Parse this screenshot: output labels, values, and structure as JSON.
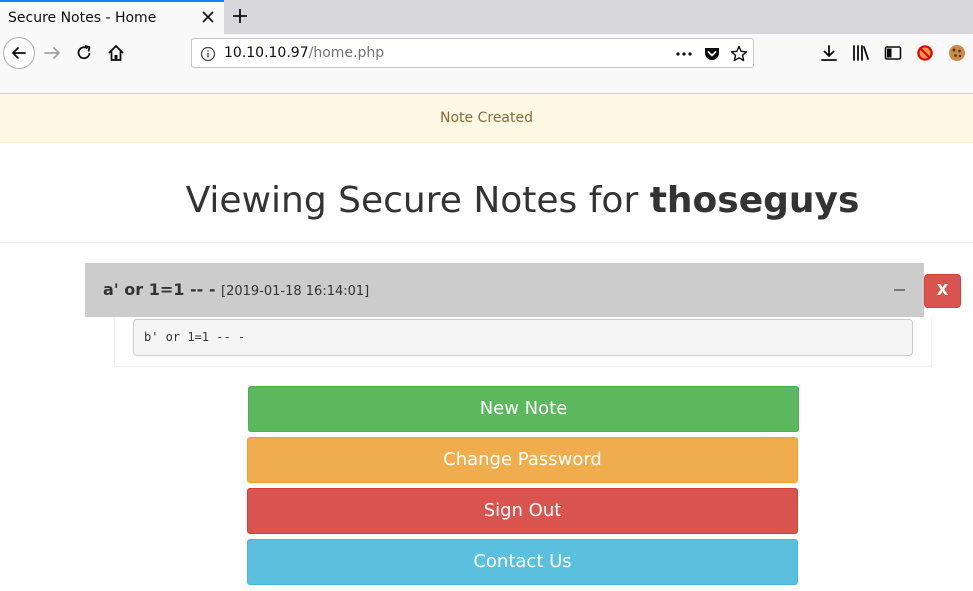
{
  "browser": {
    "tab_title": "Secure Notes - Home",
    "url_host": "10.10.10.97",
    "url_path": "/home.php"
  },
  "alert": {
    "text": "Note Created"
  },
  "page": {
    "heading_prefix": "Viewing Secure Notes for ",
    "heading_user": "thoseguys"
  },
  "note": {
    "title": "a' or 1=1 -- -",
    "date": "[2019-01-18 16:14:01]",
    "body": "b' or 1=1 -- -",
    "delete_label": "X"
  },
  "buttons": {
    "new_note": "New Note",
    "change_password": "Change Password",
    "sign_out": "Sign Out",
    "contact_us": "Contact Us"
  },
  "colors": {
    "success": "#5cb85c",
    "warning": "#f0ad4e",
    "danger": "#d9534f",
    "info": "#5bc0de",
    "alert_bg": "#fcf8e3"
  }
}
